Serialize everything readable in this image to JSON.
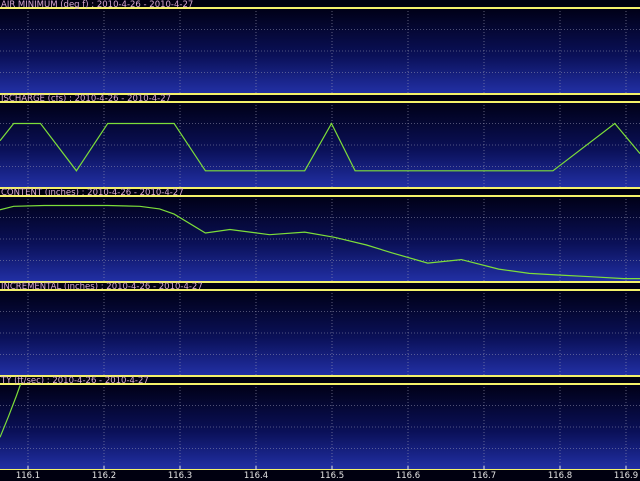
{
  "colors": {
    "background": "#000010",
    "border": "#f4f16a",
    "grid": "#9a9ab4",
    "series": "#7dde3a",
    "title": "#d7a8d2",
    "tick": "#e4e4e4"
  },
  "x_ticks": [
    "116.1",
    "116.2",
    "116.3",
    "116.4",
    "116.5",
    "116.6",
    "116.7",
    "116.8",
    "116.9"
  ],
  "chart_data": [
    {
      "type": "line",
      "title": "AIR MINIMUM (deg f) : 2010-4-26 - 2010-4-27",
      "xlim": [
        116.077,
        116.915
      ],
      "ylim": [
        0,
        1
      ],
      "x": [],
      "y": []
    },
    {
      "type": "line",
      "title": "ISCHARGE (cfs) : 2010-4-26 - 2010-4-27",
      "xlim": [
        116.077,
        116.915
      ],
      "ylim": [
        0,
        1
      ],
      "x": [
        116.077,
        116.095,
        116.13,
        116.177,
        116.218,
        116.255,
        116.305,
        116.346,
        116.398,
        116.434,
        116.476,
        116.511,
        116.542,
        116.584,
        116.66,
        116.735,
        116.801,
        116.882,
        116.915
      ],
      "y": [
        0.55,
        0.75,
        0.75,
        0.2,
        0.75,
        0.75,
        0.75,
        0.2,
        0.2,
        0.2,
        0.2,
        0.75,
        0.2,
        0.2,
        0.2,
        0.2,
        0.2,
        0.75,
        0.4
      ]
    },
    {
      "type": "line",
      "title": "CONTENT (inches) : 2010-4-26 - 2010-4-27",
      "xlim": [
        116.077,
        116.915
      ],
      "ylim": [
        0,
        1
      ],
      "x": [
        116.077,
        116.095,
        116.135,
        116.177,
        116.218,
        116.26,
        116.286,
        116.305,
        116.346,
        116.378,
        116.43,
        116.476,
        116.515,
        116.557,
        116.59,
        116.637,
        116.681,
        116.73,
        116.77,
        116.811,
        116.853,
        116.894,
        116.915
      ],
      "y": [
        0.84,
        0.88,
        0.89,
        0.89,
        0.89,
        0.88,
        0.85,
        0.79,
        0.57,
        0.61,
        0.55,
        0.58,
        0.52,
        0.43,
        0.34,
        0.22,
        0.26,
        0.15,
        0.1,
        0.08,
        0.06,
        0.04,
        0.04
      ]
    },
    {
      "type": "line",
      "title": "INCREMENTAL (inches) : 2010-4-26 - 2010-4-27",
      "xlim": [
        116.077,
        116.915
      ],
      "ylim": [
        0,
        1
      ],
      "x": [],
      "y": []
    },
    {
      "type": "line",
      "title": "TY (ft/sec) : 2010-4-26 - 2010-4-27",
      "xlim": [
        116.077,
        116.915
      ],
      "ylim": [
        0,
        1
      ],
      "x": [
        116.077,
        116.088,
        116.098,
        116.104
      ],
      "y": [
        0.38,
        0.62,
        0.85,
        1.0
      ]
    }
  ]
}
